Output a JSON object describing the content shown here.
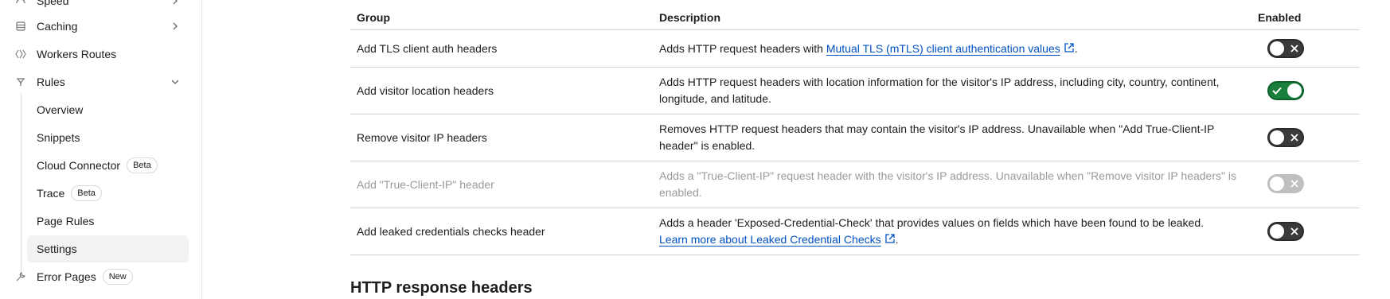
{
  "sidebar": {
    "items": [
      {
        "label": "Speed"
      },
      {
        "label": "Caching"
      },
      {
        "label": "Workers Routes"
      },
      {
        "label": "Rules"
      },
      {
        "label": "Error Pages",
        "badge": "New"
      }
    ],
    "rules_subitems": [
      {
        "label": "Overview"
      },
      {
        "label": "Snippets"
      },
      {
        "label": "Cloud Connector",
        "badge": "Beta"
      },
      {
        "label": "Trace",
        "badge": "Beta"
      },
      {
        "label": "Page Rules"
      },
      {
        "label": "Settings",
        "selected": true
      }
    ]
  },
  "table": {
    "headers": {
      "group": "Group",
      "description": "Description",
      "enabled": "Enabled"
    },
    "rows": [
      {
        "group": "Add TLS client auth headers",
        "desc_prefix": "Adds HTTP request headers with ",
        "desc_link": "Mutual TLS (mTLS) client authentication values",
        "desc_suffix": ".",
        "enabled": false
      },
      {
        "group": "Add visitor location headers",
        "description": "Adds HTTP request headers with location information for the visitor's IP address, including city, country, continent, longitude, and latitude.",
        "enabled": true
      },
      {
        "group": "Remove visitor IP headers",
        "description": "Removes HTTP request headers that may contain the visitor's IP address. Unavailable when \"Add True-Client-IP header\" is enabled.",
        "enabled": false
      },
      {
        "group": "Add \"True-Client-IP\" header",
        "description": "Adds a \"True-Client-IP\" request header with the visitor's IP address. Unavailable when \"Remove visitor IP headers\" is enabled.",
        "enabled": false,
        "disabled": true
      },
      {
        "group": "Add leaked credentials checks header",
        "desc_prefix": "Adds a header 'Exposed-Credential-Check' that provides values on fields which have been found to be leaked.",
        "desc_link": "Learn more about Leaked Credential Checks",
        "desc_suffix": ".",
        "enabled": false
      }
    ]
  },
  "section": {
    "title": "HTTP response headers"
  },
  "colors": {
    "link": "#0051c3",
    "toggle_on": "#1a7f3c",
    "toggle_off": "#3a3a3a"
  }
}
